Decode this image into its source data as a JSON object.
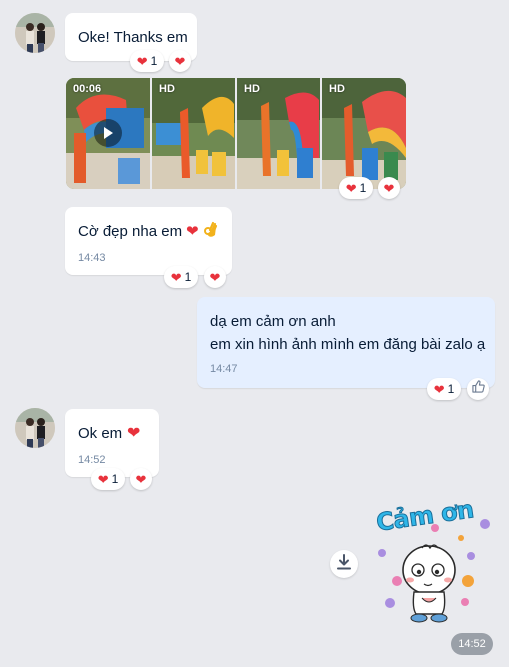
{
  "messages": {
    "m1": {
      "text": "Oke! Thanks em",
      "reaction_count": "1"
    },
    "media": {
      "duration": "00:06",
      "hd_label": "HD",
      "reaction_count": "1"
    },
    "m2": {
      "text": "Cờ đẹp nha em",
      "time": "14:43",
      "reaction_count": "1"
    },
    "m3": {
      "line1": "dạ em cảm ơn anh",
      "line2": "em xin hình ảnh mình em đăng bài zalo ạ",
      "time": "14:47",
      "reaction_count": "1"
    },
    "m4": {
      "text": "Ok em",
      "time": "14:52",
      "reaction_count": "1"
    },
    "sticker": {
      "text": "Cảm ơn",
      "time": "14:52"
    }
  },
  "colors": {
    "background": "#e9eaee",
    "my_bubble": "#e5efff",
    "heart": "#e8323c",
    "timestamp": "#7589a3"
  },
  "icons": [
    "avatar",
    "heart-icon",
    "ok-hand-icon",
    "play-icon",
    "thumbs-up-icon",
    "download-icon"
  ]
}
